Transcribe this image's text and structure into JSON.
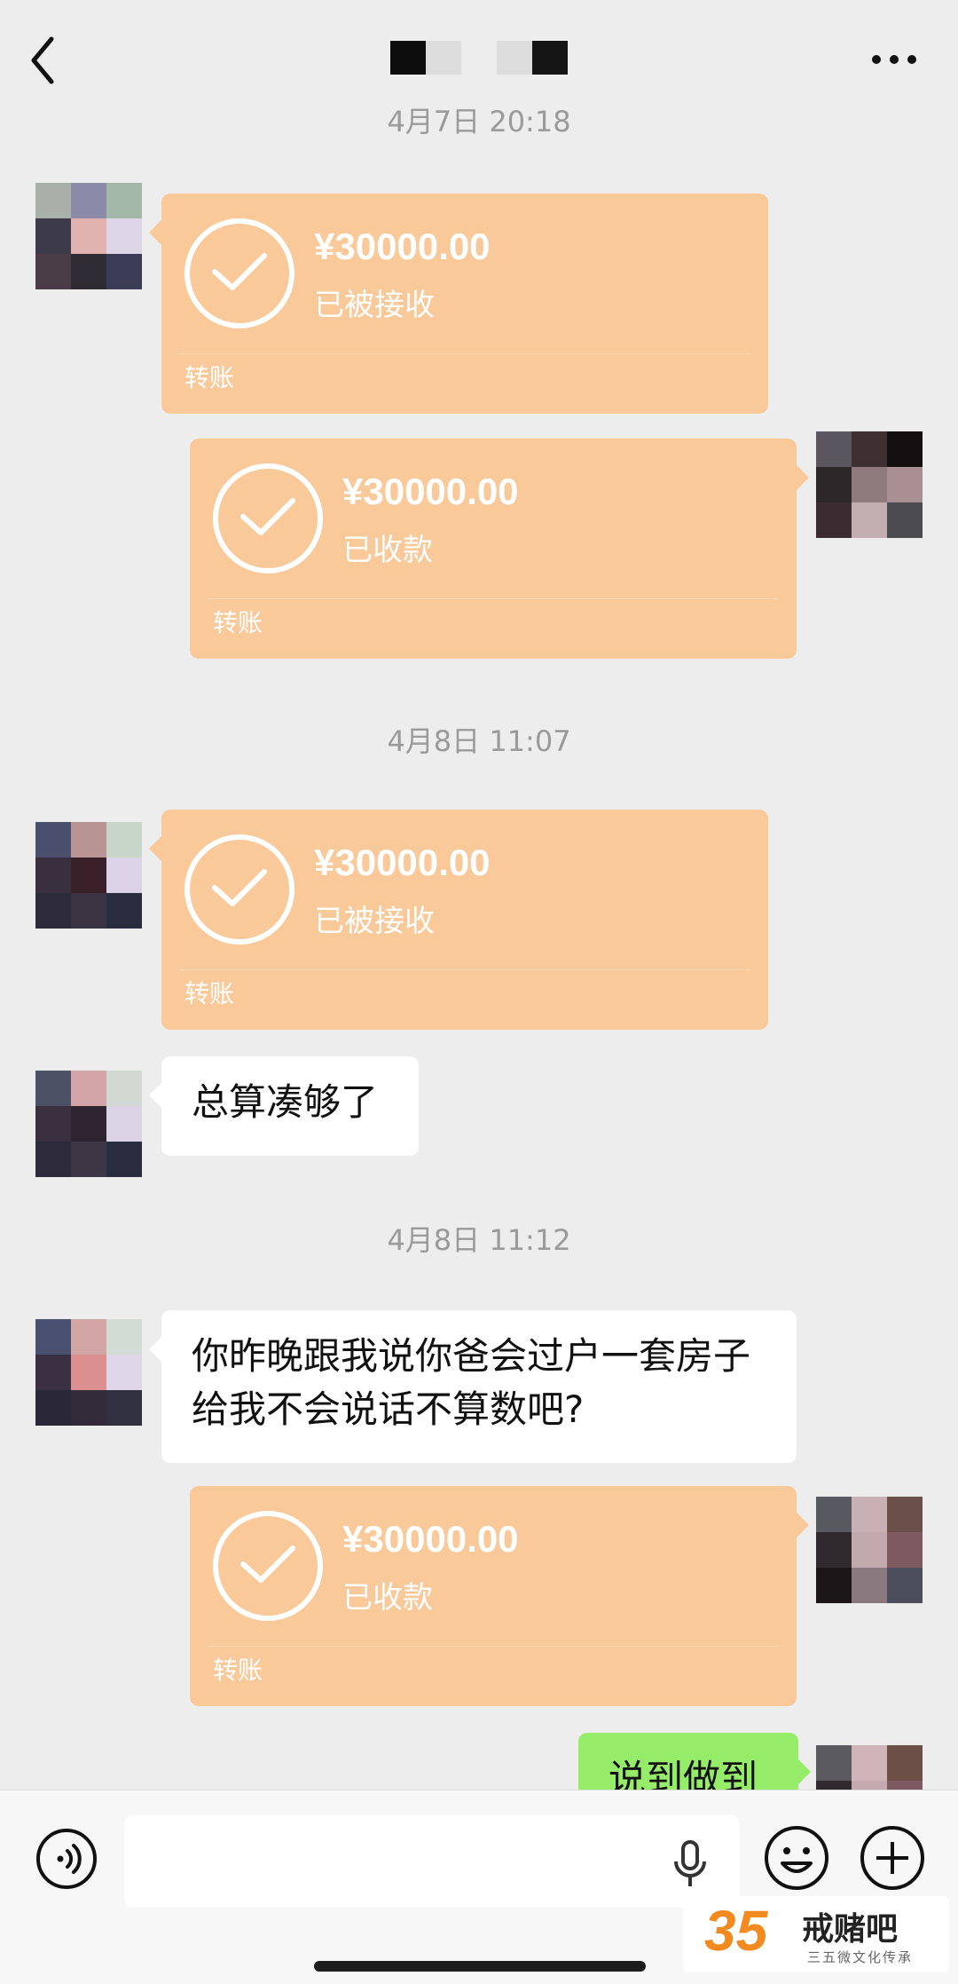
{
  "header": {
    "back_icon": "chevron-left-icon",
    "more_icon": "more-horizontal-icon"
  },
  "messages": [
    {
      "type": "timestamp",
      "text": "4月7日 20:18"
    },
    {
      "type": "transfer",
      "side": "left",
      "amount": "¥30000.00",
      "status": "已被接收",
      "kind": "转账"
    },
    {
      "type": "transfer",
      "side": "right",
      "amount": "¥30000.00",
      "status": "已收款",
      "kind": "转账"
    },
    {
      "type": "timestamp",
      "text": "4月8日 11:07"
    },
    {
      "type": "transfer",
      "side": "left",
      "amount": "¥30000.00",
      "status": "已被接收",
      "kind": "转账"
    },
    {
      "type": "text",
      "side": "left",
      "text": "总算凑够了"
    },
    {
      "type": "timestamp",
      "text": "4月8日 11:12"
    },
    {
      "type": "text",
      "side": "left",
      "text": "你昨晚跟我说你爸会过户一套房子给我不会说话不算数吧?"
    },
    {
      "type": "transfer",
      "side": "right",
      "amount": "¥30000.00",
      "status": "已收款",
      "kind": "转账"
    },
    {
      "type": "text",
      "side": "right",
      "text": "说到做到"
    }
  ],
  "input_bar": {
    "voice_icon": "voice-icon",
    "mic_icon": "microphone-icon",
    "emoji_icon": "emoji-icon",
    "plus_icon": "plus-icon"
  },
  "watermark": {
    "number": "35",
    "brand": "戒赌吧",
    "tagline": "三五微文化传承"
  },
  "colors": {
    "transfer_bg": "#f9c99a",
    "self_bubble": "#95ec69",
    "background": "#ededed"
  }
}
